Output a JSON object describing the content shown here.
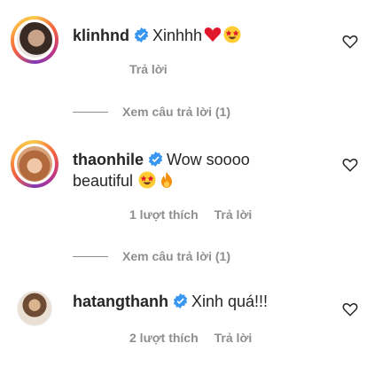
{
  "comments": [
    {
      "username": "klinhnd",
      "text": "Xinhhh",
      "likes": "",
      "reply_label": "Trả lời",
      "view_replies": "Xem câu trả lời (1)"
    },
    {
      "username": "thaonhile",
      "text_line1": "Wow soooo",
      "text_line2": "beautiful",
      "likes": "1 lượt thích",
      "reply_label": "Trả lời",
      "view_replies": "Xem câu trả lời (1)"
    },
    {
      "username": "hatangthanh",
      "text": "Xinh quá!!!",
      "likes": "2 lượt thích",
      "reply_label": "Trả lời"
    }
  ],
  "icons": {
    "verified": "verified-badge-icon",
    "heart": "heart-outline-icon",
    "red_heart": "red-heart-emoji",
    "star_eyes": "star-struck-emoji",
    "fire": "fire-emoji"
  },
  "colors": {
    "verified_blue": "#3897f0",
    "meta_gray": "#8e8e8e",
    "text": "#262626"
  }
}
